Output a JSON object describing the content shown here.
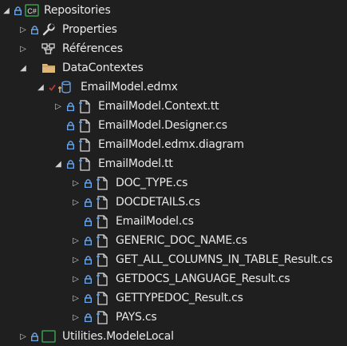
{
  "tree": {
    "items": [
      {
        "label": "Repositories",
        "icon": "csharp-project-icon"
      },
      {
        "label": "Properties",
        "icon": "wrench-icon"
      },
      {
        "label": "Références",
        "icon": "references-icon"
      },
      {
        "label": "DataContextes",
        "icon": "folder-icon"
      },
      {
        "label": "EmailModel.edmx",
        "icon": "edmx-icon"
      },
      {
        "label": "EmailModel.Context.tt",
        "icon": "file-icon"
      },
      {
        "label": "EmailModel.Designer.cs",
        "icon": "file-icon"
      },
      {
        "label": "EmailModel.edmx.diagram",
        "icon": "file-icon"
      },
      {
        "label": "EmailModel.tt",
        "icon": "file-icon"
      },
      {
        "label": "DOC_TYPE.cs",
        "icon": "file-icon"
      },
      {
        "label": "DOCDETAILS.cs",
        "icon": "file-icon"
      },
      {
        "label": "EmailModel.cs",
        "icon": "file-icon"
      },
      {
        "label": "GENERIC_DOC_NAME.cs",
        "icon": "file-icon"
      },
      {
        "label": "GET_ALL_COLUMNS_IN_TABLE_Result.cs",
        "icon": "file-icon"
      },
      {
        "label": "GETDOCS_LANGUAGE_Result.cs",
        "icon": "file-icon"
      },
      {
        "label": "GETTYPEDOC_Result.cs",
        "icon": "file-icon"
      },
      {
        "label": "PAYS.cs",
        "icon": "file-icon"
      },
      {
        "label": "Utilities.ModeleLocal",
        "icon": "csharp-project-icon"
      }
    ]
  },
  "colors": {
    "background": "#1f1f1f",
    "text": "#e8e8e8",
    "lock": "#6aa6e8",
    "folder": "#dcb67a",
    "csharp": "#3a9b4a",
    "checkmark": "#c23b3b"
  }
}
